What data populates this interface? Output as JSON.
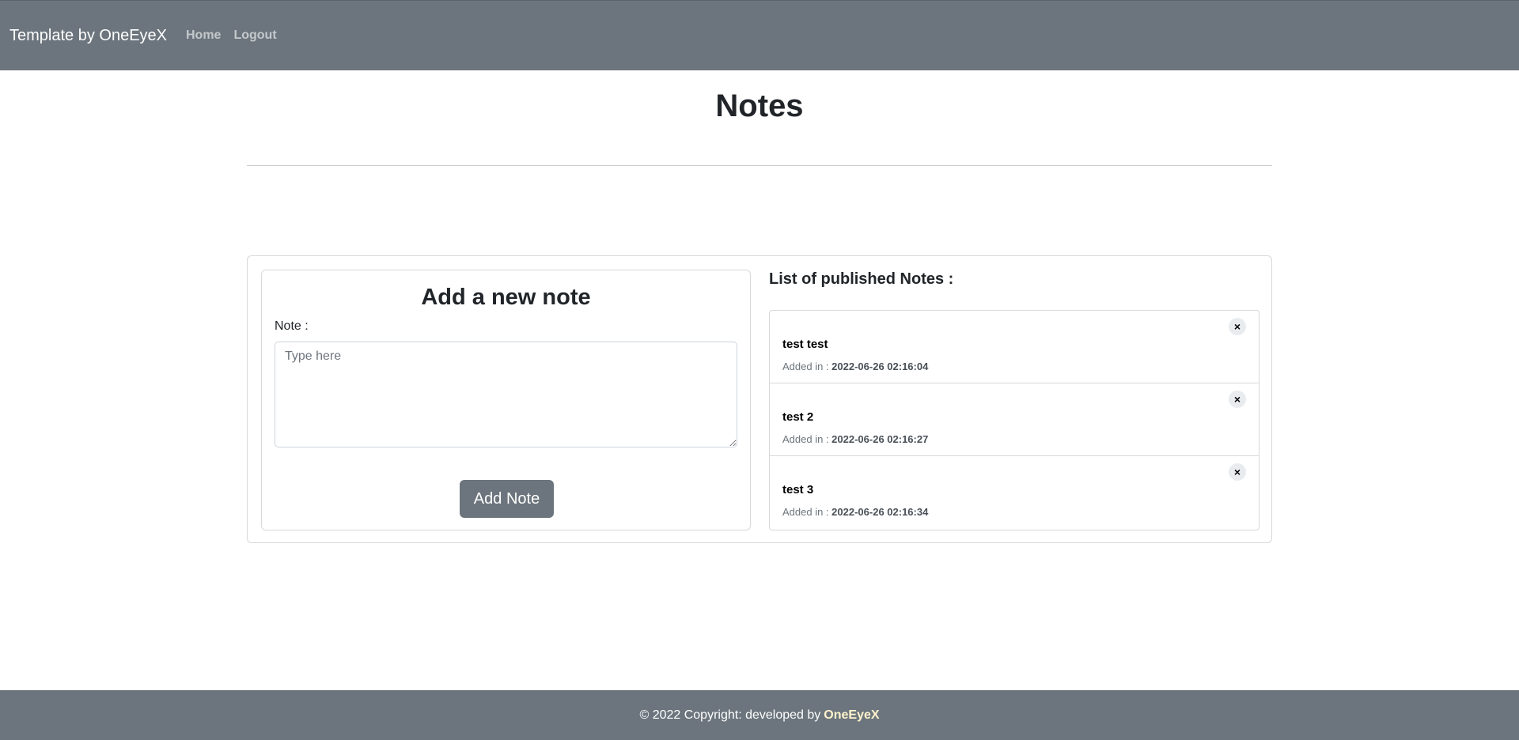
{
  "navbar": {
    "brand": "Template by OneEyeX",
    "links": [
      {
        "label": "Home"
      },
      {
        "label": "Logout"
      }
    ]
  },
  "page": {
    "title": "Notes"
  },
  "form": {
    "title": "Add a new note",
    "label": "Note :",
    "placeholder": "Type here",
    "value": "",
    "button_label": "Add Note"
  },
  "list": {
    "title": "List of published Notes :",
    "added_prefix": "Added in :",
    "close_glyph": "×",
    "notes": [
      {
        "title": "test test",
        "date": "2022-06-26 02:16:04"
      },
      {
        "title": "test 2",
        "date": "2022-06-26 02:16:27"
      },
      {
        "title": "test 3",
        "date": "2022-06-26 02:16:34"
      }
    ]
  },
  "footer": {
    "text": "© 2022 Copyright: developed by",
    "brand": "OneEyeX"
  },
  "colors": {
    "navbar_bg": "#6c757d",
    "footer_bg": "#6c757d",
    "button_bg": "#6c757d"
  }
}
